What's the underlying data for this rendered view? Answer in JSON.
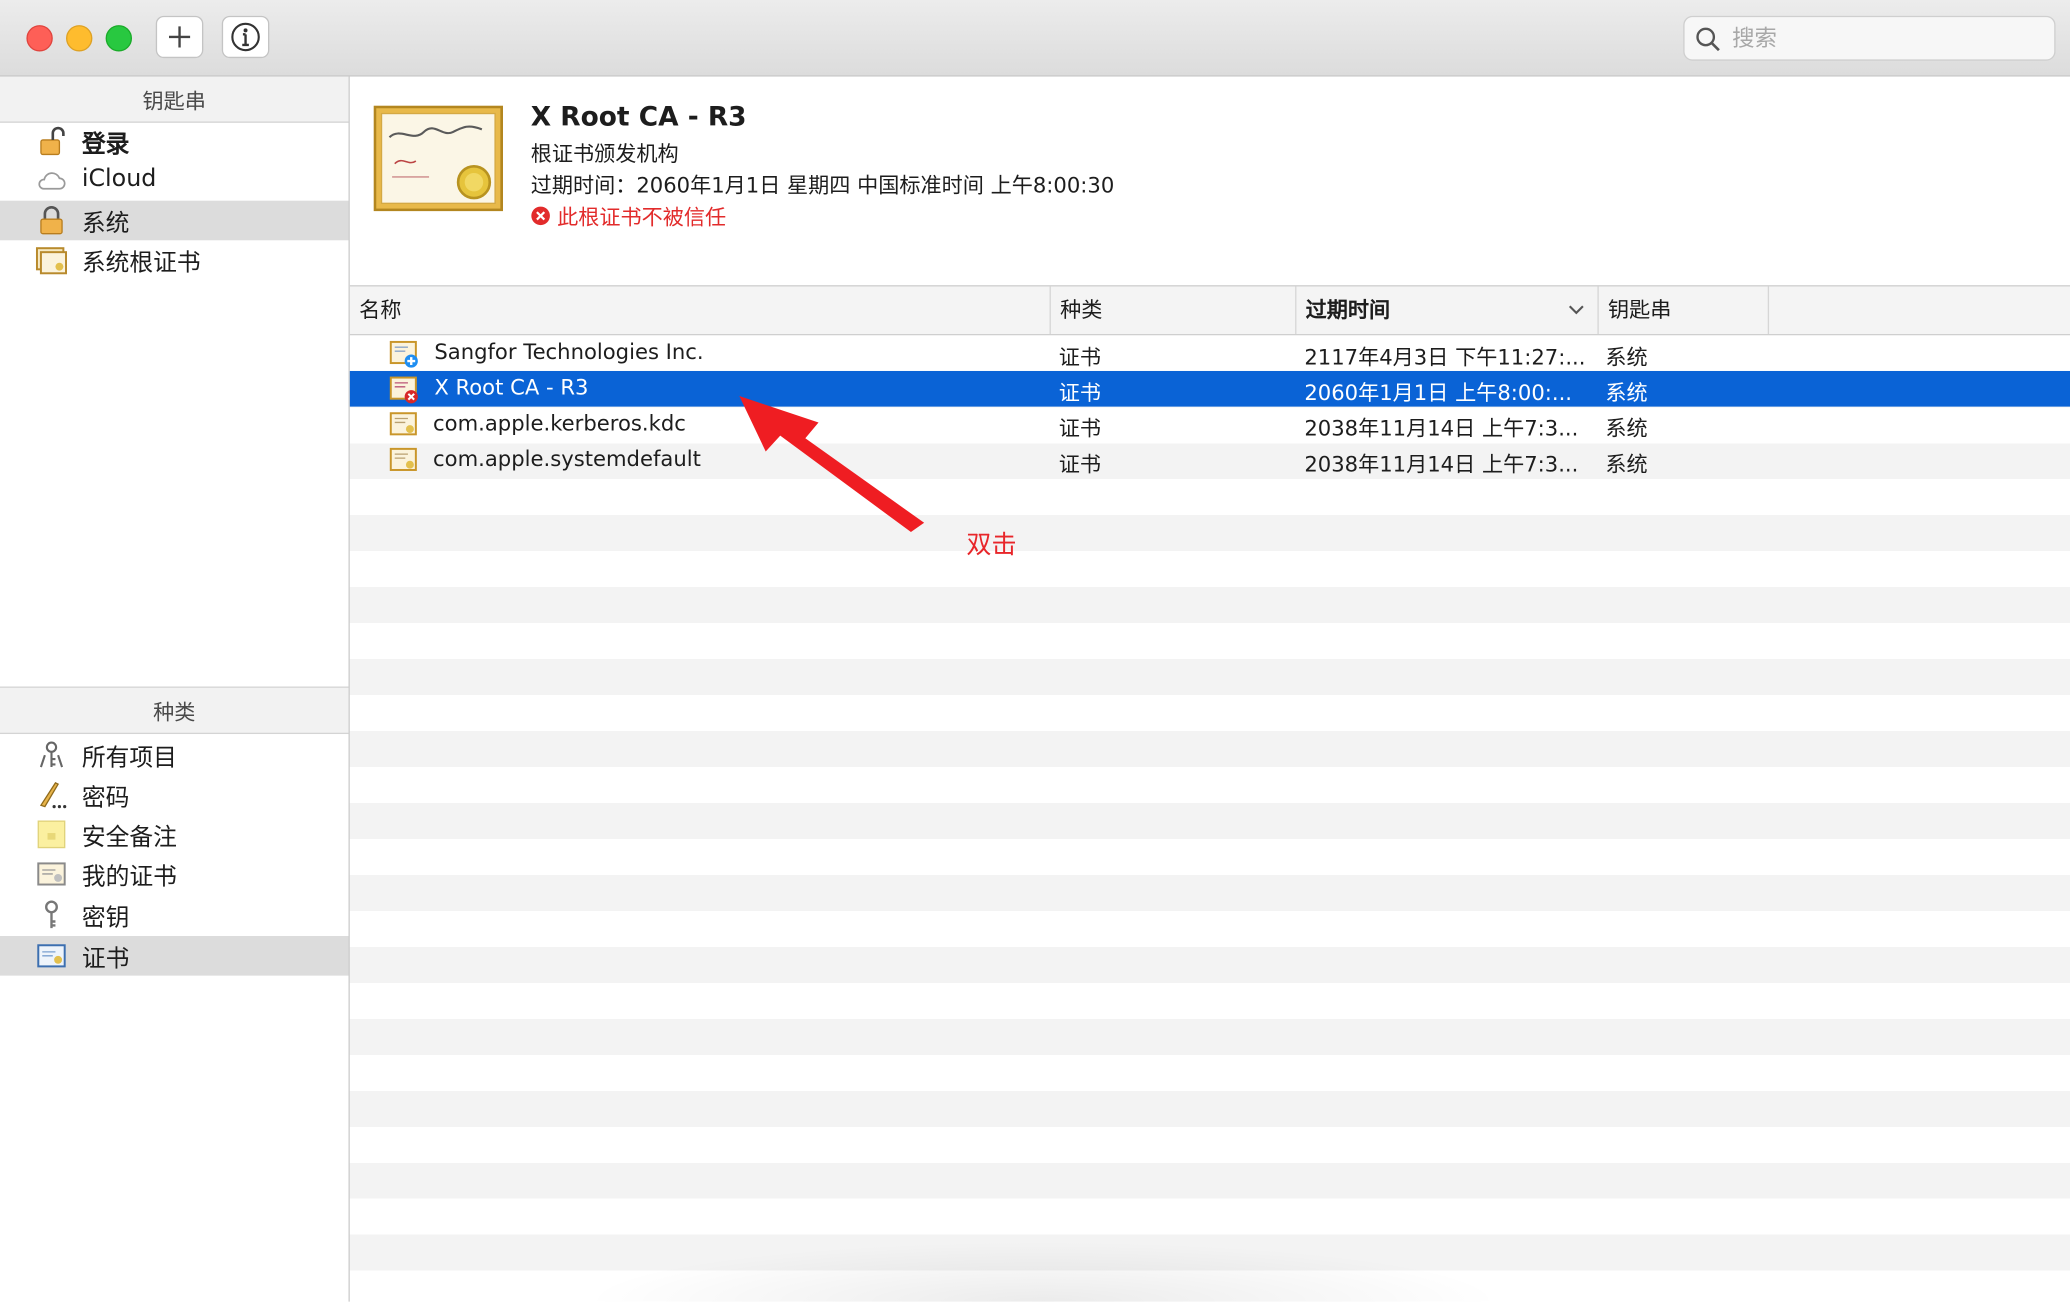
{
  "window": {
    "search_placeholder": "搜索"
  },
  "sidebar": {
    "keychains_header": "钥匙串",
    "keychains": [
      {
        "label": "登录",
        "icon": "lock-open-icon",
        "bold": true
      },
      {
        "label": "iCloud",
        "icon": "cloud-icon"
      },
      {
        "label": "系统",
        "icon": "lock-icon",
        "selected": true
      },
      {
        "label": "系统根证书",
        "icon": "certificate-cabinet-icon"
      }
    ],
    "category_header": "种类",
    "categories": [
      {
        "label": "所有项目",
        "icon": "all-items-icon"
      },
      {
        "label": "密码",
        "icon": "password-icon"
      },
      {
        "label": "安全备注",
        "icon": "secure-note-icon"
      },
      {
        "label": "我的证书",
        "icon": "my-certificate-icon"
      },
      {
        "label": "密钥",
        "icon": "key-icon"
      },
      {
        "label": "证书",
        "icon": "certificate-icon",
        "selected": true
      }
    ]
  },
  "detail": {
    "title": "X Root CA - R3",
    "subtitle": "根证书颁发机构",
    "expires": "过期时间：2060年1月1日 星期四 中国标准时间 上午8:00:30",
    "warning": "此根证书不被信任",
    "warning_color": "#e22b2b"
  },
  "table": {
    "columns": [
      "名称",
      "种类",
      "过期时间",
      "钥匙串"
    ],
    "rows": [
      {
        "name": "Sangfor Technologies Inc.",
        "kind": "证书",
        "expires": "2117年4月3日 下午11:27:...",
        "keychain": "系统",
        "icon": "certificate-plus-icon"
      },
      {
        "name": "X Root CA - R3",
        "kind": "证书",
        "expires": "2060年1月1日 上午8:00:...",
        "keychain": "系统",
        "icon": "certificate-untrusted-icon",
        "selected": true
      },
      {
        "name": "com.apple.kerberos.kdc",
        "kind": "证书",
        "expires": "2038年11月14日 上午7:3...",
        "keychain": "系统",
        "icon": "certificate-icon"
      },
      {
        "name": "com.apple.systemdefault",
        "kind": "证书",
        "expires": "2038年11月14日 上午7:3...",
        "keychain": "系统",
        "icon": "certificate-icon"
      }
    ]
  },
  "annotation": {
    "label": "双击",
    "color": "#e8262a"
  },
  "colors": {
    "selection": "#0a63d6",
    "sidebar_selection": "#dcdcdc"
  }
}
